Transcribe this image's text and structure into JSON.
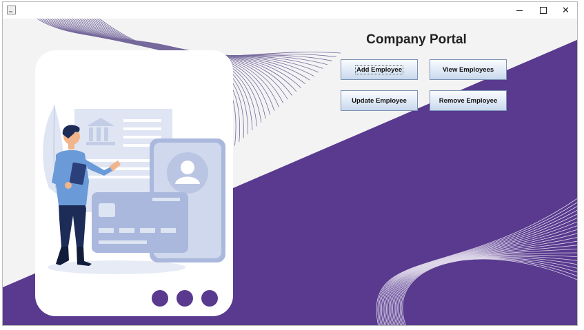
{
  "window": {
    "controls": {
      "minimize": "minimize-icon",
      "maximize": "maximize-icon",
      "close": "close-icon"
    }
  },
  "main": {
    "title": "Company Portal",
    "buttons": {
      "add": "Add Employee",
      "view": "View Employees",
      "update": "Update Employee",
      "remove": "Remove Employee"
    }
  },
  "illustration": {
    "icons": [
      "person-icon",
      "bank-icon",
      "id-card-icon",
      "credit-card-icon",
      "tablet-icon",
      "leaf-icon"
    ],
    "carousel_dots": 3
  },
  "colors": {
    "accent": "#593a8f",
    "background": "#f3f3f4",
    "illustration_light": "#cfd8ec",
    "illustration_mid": "#aab8dd",
    "shirt": "#6a9bd8",
    "pants": "#1d2b57"
  }
}
